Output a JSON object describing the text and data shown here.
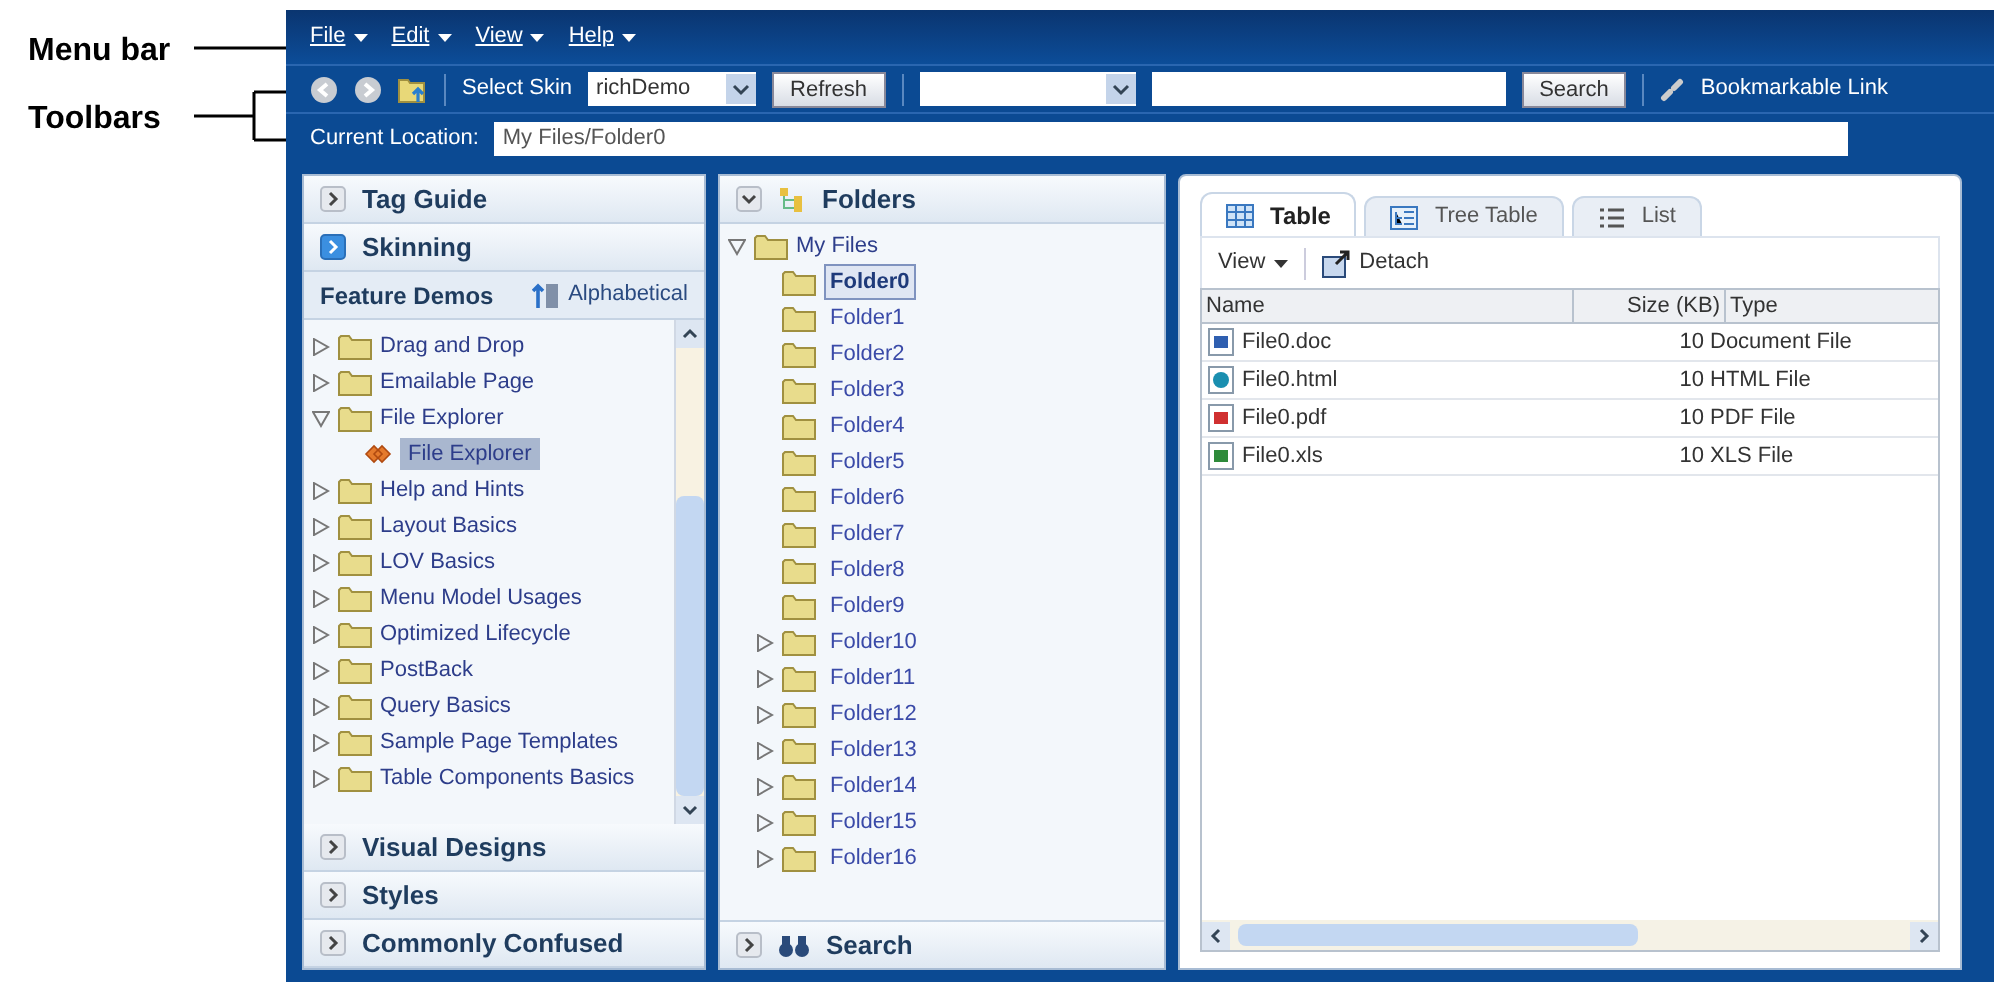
{
  "annotations": [
    {
      "label": "Menu bar"
    },
    {
      "label": "Toolbars"
    }
  ],
  "menu_bar": [
    "File",
    "Edit",
    "View",
    "Help"
  ],
  "toolbar": {
    "skin_label": "Select Skin",
    "skin_value": "richDemo",
    "refresh_button": "Refresh",
    "search_button": "Search",
    "bookmark_link": "Bookmarkable Link"
  },
  "location": {
    "label": "Current Location:",
    "value": "My Files/Folder0"
  },
  "left_panel": {
    "top_sections": [
      {
        "title": "Tag Guide",
        "selected": false
      },
      {
        "title": "Skinning",
        "selected": true
      }
    ],
    "open_section": {
      "title": "Feature Demos",
      "sort_label": "Alphabetical",
      "items": [
        {
          "label": "Drag and Drop",
          "expanded": false
        },
        {
          "label": "Emailable Page",
          "expanded": false
        },
        {
          "label": "File Explorer",
          "expanded": true,
          "children": [
            {
              "label": "File Explorer",
              "selected": true
            }
          ]
        },
        {
          "label": "Help and Hints",
          "expanded": false
        },
        {
          "label": "Layout Basics",
          "expanded": false
        },
        {
          "label": "LOV Basics",
          "expanded": false
        },
        {
          "label": "Menu Model Usages",
          "expanded": false
        },
        {
          "label": "Optimized Lifecycle",
          "expanded": false
        },
        {
          "label": "PostBack",
          "expanded": false
        },
        {
          "label": "Query Basics",
          "expanded": false
        },
        {
          "label": "Sample Page Templates",
          "expanded": false
        },
        {
          "label": "Table Components Basics",
          "expanded": false
        }
      ]
    },
    "bottom_sections": [
      {
        "title": "Visual Designs",
        "selected": false
      },
      {
        "title": "Styles",
        "selected": false
      },
      {
        "title": "Commonly Confused",
        "selected": false
      }
    ]
  },
  "folders_panel": {
    "title": "Folders",
    "root": {
      "label": "My Files",
      "expanded": true,
      "children": [
        {
          "label": "Folder0",
          "selected": true,
          "expandable": false
        },
        {
          "label": "Folder1",
          "selected": false,
          "expandable": false
        },
        {
          "label": "Folder2",
          "selected": false,
          "expandable": false
        },
        {
          "label": "Folder3",
          "selected": false,
          "expandable": false
        },
        {
          "label": "Folder4",
          "selected": false,
          "expandable": false
        },
        {
          "label": "Folder5",
          "selected": false,
          "expandable": false
        },
        {
          "label": "Folder6",
          "selected": false,
          "expandable": false
        },
        {
          "label": "Folder7",
          "selected": false,
          "expandable": false
        },
        {
          "label": "Folder8",
          "selected": false,
          "expandable": false
        },
        {
          "label": "Folder9",
          "selected": false,
          "expandable": false
        },
        {
          "label": "Folder10",
          "selected": false,
          "expandable": true
        },
        {
          "label": "Folder11",
          "selected": false,
          "expandable": true
        },
        {
          "label": "Folder12",
          "selected": false,
          "expandable": true
        },
        {
          "label": "Folder13",
          "selected": false,
          "expandable": true
        },
        {
          "label": "Folder14",
          "selected": false,
          "expandable": true
        },
        {
          "label": "Folder15",
          "selected": false,
          "expandable": true
        },
        {
          "label": "Folder16",
          "selected": false,
          "expandable": true
        }
      ]
    },
    "search_section": "Search"
  },
  "content_panel": {
    "tabs": [
      {
        "label": "Table",
        "kind": "table",
        "selected": true
      },
      {
        "label": "Tree Table",
        "kind": "treetable",
        "selected": false
      },
      {
        "label": "List",
        "kind": "list",
        "selected": false
      }
    ],
    "view_menu": "View",
    "detach_button": "Detach",
    "table": {
      "columns": [
        "Name",
        "Size (KB)",
        "Type"
      ],
      "rows": [
        {
          "kind": "doc",
          "name": "File0.doc",
          "size": "10",
          "type": "Document File"
        },
        {
          "kind": "html",
          "name": "File0.html",
          "size": "10",
          "type": "HTML File"
        },
        {
          "kind": "pdf",
          "name": "File0.pdf",
          "size": "10",
          "type": "PDF File"
        },
        {
          "kind": "xls",
          "name": "File0.xls",
          "size": "10",
          "type": "XLS File"
        }
      ]
    }
  }
}
